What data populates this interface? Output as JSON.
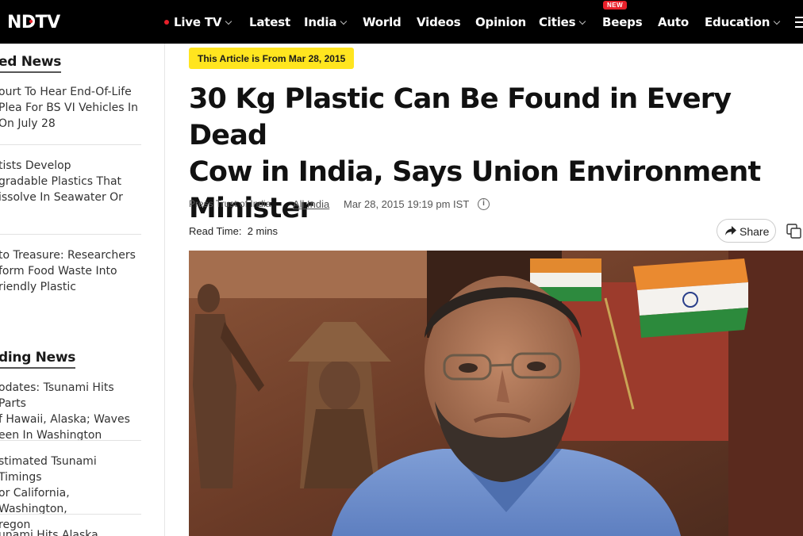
{
  "nav": {
    "logo": "NDTV",
    "items": [
      {
        "label": "Live TV"
      },
      {
        "label": "Latest"
      },
      {
        "label": "India"
      },
      {
        "label": "World"
      },
      {
        "label": "Videos"
      },
      {
        "label": "Opinion"
      },
      {
        "label": "Cities"
      },
      {
        "label": "Beeps"
      },
      {
        "label": "Auto"
      },
      {
        "label": "Education"
      }
    ],
    "beeps_badge": "NEW",
    "brand_red": "#e8202a"
  },
  "sidebar": {
    "related_title": "ed News",
    "related": [
      {
        "lines": [
          "ourt To Hear End-Of-Life",
          "Plea For BS VI Vehicles In",
          "On July 28"
        ]
      },
      {
        "lines": [
          "tists Develop",
          "gradable Plastics That",
          "issolve In Seawater Or"
        ]
      },
      {
        "lines": [
          "to Treasure: Researchers",
          "form Food Waste Into",
          "riendly Plastic"
        ]
      }
    ],
    "trending_title": "ding News",
    "trending": [
      {
        "lines": [
          "odates: Tsunami Hits Parts",
          "f Hawaii, Alaska; Waves",
          "een In Washington"
        ]
      },
      {
        "lines": [
          "stimated Tsunami Timings",
          "or California, Washington,",
          "regon"
        ]
      },
      {
        "lines": [
          "unami Hits Alaska"
        ]
      }
    ]
  },
  "article": {
    "date_badge": "This Article is From Mar 28, 2015",
    "headline_lines": [
      "30 Kg Plastic Can Be Found in Every Dead",
      "Cow in India, Says Union Environment",
      "Minister"
    ],
    "author": "Press Trust of India",
    "place": "All India",
    "datetime": "Mar 28, 2015 19:19 pm IST",
    "read_time_label": "Read Time:",
    "read_time_value": "2 mins",
    "share_label": "Share"
  }
}
